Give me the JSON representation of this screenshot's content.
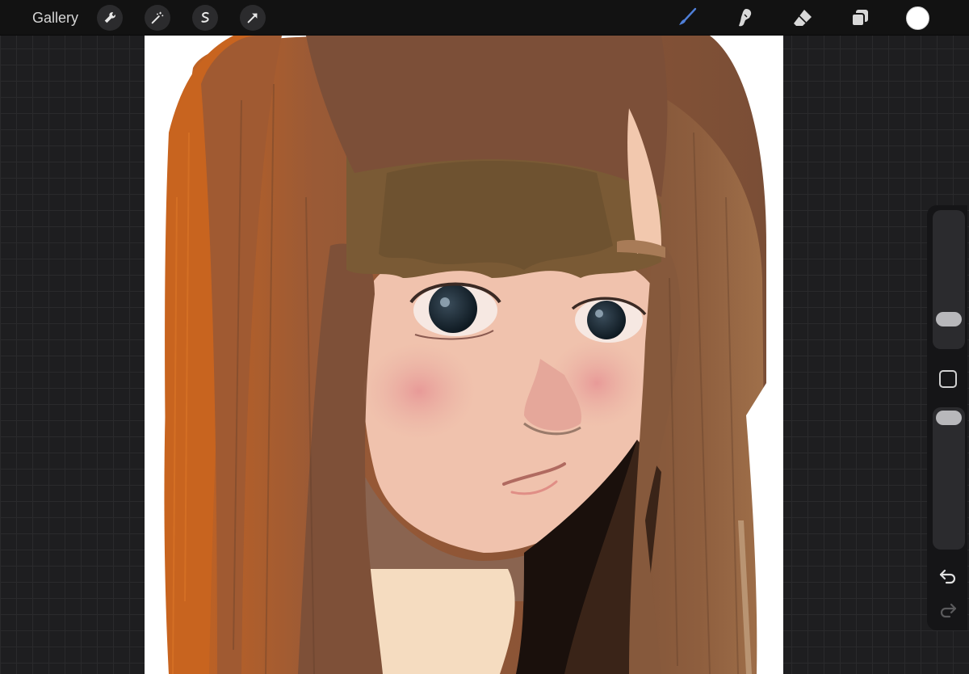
{
  "toolbar": {
    "gallery_label": "Gallery",
    "left_tools": [
      "wrench-icon",
      "magic-wand-icon",
      "selection-icon",
      "transform-arrow-icon"
    ],
    "right_tools": [
      "brush-icon",
      "smudge-icon",
      "eraser-icon",
      "layers-icon"
    ],
    "active_tool": "brush-icon",
    "accent_color": "#4f7fd8",
    "current_color": "#ffffff"
  },
  "sidebar": {
    "brush_size_level": 0.35,
    "opacity_level": 0.95,
    "buttons": [
      "modify-button",
      "undo-icon",
      "redo-icon"
    ]
  },
  "canvas": {
    "content": "painting-of-girl-with-brown-hair"
  }
}
